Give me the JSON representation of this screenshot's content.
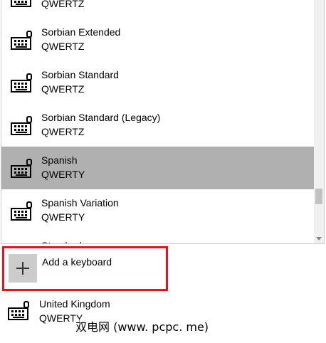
{
  "keyboard_list": {
    "items": [
      {
        "name": "",
        "layout": "QWERTZ",
        "selected": false
      },
      {
        "name": "Sorbian Extended",
        "layout": "QWERTZ",
        "selected": false
      },
      {
        "name": "Sorbian Standard",
        "layout": "QWERTZ",
        "selected": false
      },
      {
        "name": "Sorbian Standard (Legacy)",
        "layout": "QWERTZ",
        "selected": false
      },
      {
        "name": "Spanish",
        "layout": "QWERTY",
        "selected": true
      },
      {
        "name": "Spanish Variation",
        "layout": "QWERTY",
        "selected": false
      },
      {
        "name": "Standard",
        "layout": "",
        "selected": false
      }
    ],
    "icon": "keyboard-icon",
    "selected_color": "#b0b0b0"
  },
  "add_keyboard": {
    "label": "Add a keyboard",
    "icon": "plus-icon",
    "highlight_color": "#e5131d"
  },
  "installed_keyboard": {
    "name": "United Kingdom",
    "layout": "QWERTY",
    "icon": "keyboard-icon"
  },
  "watermark": {
    "text": "双电网 (www. pcpc. me)"
  }
}
